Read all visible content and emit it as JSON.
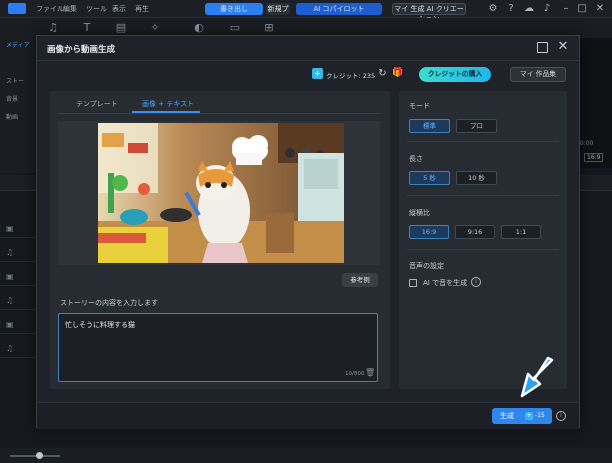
{
  "app": {
    "menu": [
      "ファイル",
      "編集",
      "ツール",
      "表示",
      "再生"
    ],
    "export_label": "書き出し",
    "new_project_label": "新規プロ",
    "ai_copilot_label": "AI コパイロット",
    "ai_creation_label": "マイ 生成 AI クリエーション",
    "left_panel_items": [
      "メディア",
      "ストー",
      "背景",
      "動画"
    ],
    "preview_time": "00:00",
    "preview_ratio": "16:9"
  },
  "dialog": {
    "title": "画像から動画生成",
    "credits_label": "クレジット: 235",
    "buy_credits_label": "クレジットの購入",
    "my_works_label": "マイ 作品集",
    "tabs": [
      "テンプレート",
      "画像 + テキスト"
    ],
    "active_tab": "画像 + テキスト",
    "reference_button": "参考例",
    "story_label": "ストーリーの内容を入力します",
    "story_text": "忙しそうに料理する猫",
    "story_count": "10/800",
    "mode": {
      "label": "モード",
      "options": [
        "標準",
        "プロ"
      ],
      "selected": "標準"
    },
    "length": {
      "label": "長さ",
      "options": [
        "5 秒",
        "10 秒"
      ],
      "selected": "5 秒"
    },
    "aspect": {
      "label": "縦横比",
      "options": [
        "16:9",
        "9:16",
        "1:1"
      ],
      "selected": "16:9"
    },
    "audio": {
      "label": "音声の設定",
      "checkbox_label": "AI で音を生成",
      "checked": false
    },
    "generate_label": "生成",
    "generate_cost": "-15"
  },
  "colors": {
    "accent": "#2f86ee",
    "credit_gradient_start": "#3ddbd0",
    "credit_gradient_end": "#1fb7e8",
    "arrow": "#2da3f0"
  },
  "icons": [
    "settings-icon",
    "help-icon",
    "cloud-icon",
    "bell-icon",
    "refresh-icon",
    "gift-icon",
    "maximize-icon",
    "close-icon",
    "trash-icon",
    "info-icon",
    "pointer-arrow-icon"
  ]
}
